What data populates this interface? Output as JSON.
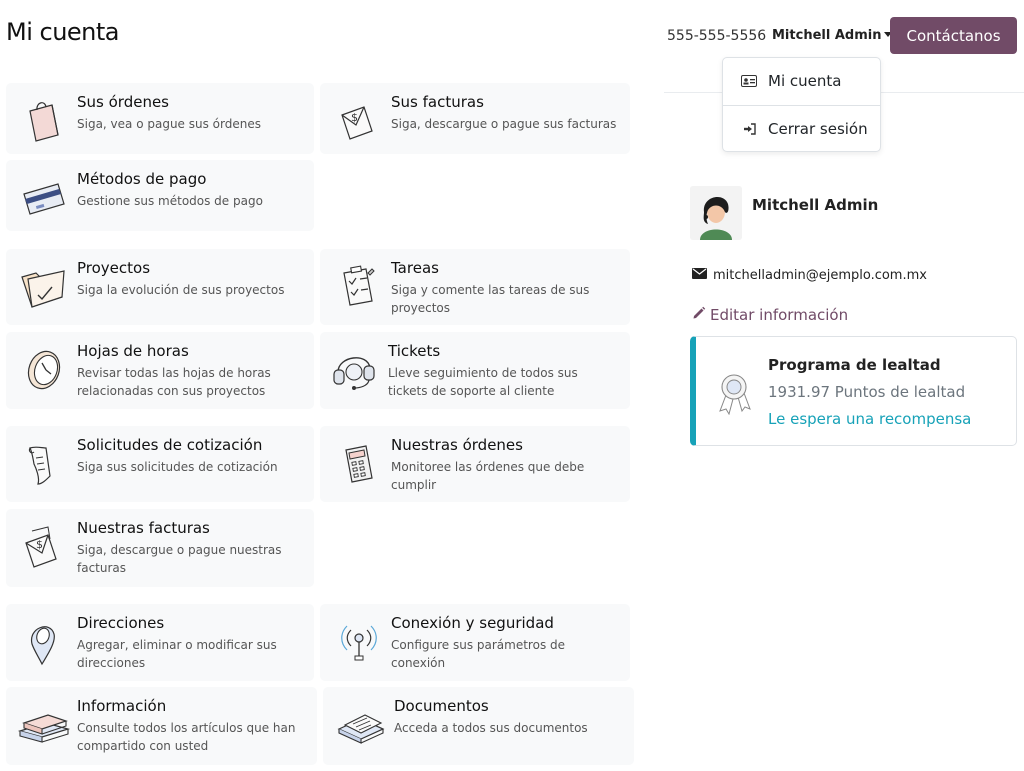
{
  "header": {
    "title": "Mi cuenta",
    "phone": "555-555-5556",
    "user_name": "Mitchell Admin",
    "contact_button": "Contáctanos"
  },
  "user_dropdown": {
    "items": [
      {
        "label": "Mi cuenta",
        "icon": "id-card-icon"
      },
      {
        "label": "Cerrar sesión",
        "icon": "sign-out-icon"
      }
    ]
  },
  "cards": [
    {
      "title": "Sus órdenes",
      "desc": "Siga, vea o pague sus órdenes",
      "icon": "shopping-bag-icon"
    },
    {
      "title": "Sus facturas",
      "desc": "Siga, descargue o pague sus facturas",
      "icon": "invoice-icon"
    },
    {
      "title": "Métodos de pago",
      "desc": "Gestione sus métodos de pago",
      "icon": "credit-card-icon"
    },
    {
      "title": "Proyectos",
      "desc": "Siga la evolución de sus proyectos",
      "icon": "folder-check-icon"
    },
    {
      "title": "Tareas",
      "desc": "Siga y comente las tareas de sus proyectos",
      "icon": "clipboard-tasks-icon"
    },
    {
      "title": "Hojas de horas",
      "desc": "Revisar todas las hojas de horas relacionadas con sus proyectos",
      "icon": "clock-icon"
    },
    {
      "title": "Tickets",
      "desc": "Lleve seguimiento de todos sus tickets de soporte al cliente",
      "icon": "headset-icon"
    },
    {
      "title": "Solicitudes de cotización",
      "desc": "Siga sus solicitudes de cotización",
      "icon": "scroll-icon"
    },
    {
      "title": "Nuestras órdenes",
      "desc": "Monitoree las órdenes que debe cumplir",
      "icon": "calculator-icon"
    },
    {
      "title": "Nuestras facturas",
      "desc": "Siga, descargue o pague nuestras facturas",
      "icon": "envelope-invoice-icon"
    },
    {
      "title": "Direcciones",
      "desc": "Agregar, eliminar o modificar sus direcciones",
      "icon": "map-pin-icon"
    },
    {
      "title": "Conexión y seguridad",
      "desc": "Configure sus parámetros de conexión",
      "icon": "security-antenna-icon"
    },
    {
      "title": "Información",
      "desc": "Consulte todos los artículos que han compartido con usted",
      "icon": "books-icon"
    },
    {
      "title": "Documentos",
      "desc": "Acceda a todos sus documentos",
      "icon": "documents-icon"
    }
  ],
  "sidebar": {
    "name": "Mitchell Admin",
    "email": "mitchelladmin@ejemplo.com.mx",
    "edit_label": "Editar información",
    "loyalty": {
      "title": "Programa de lealtad",
      "points": "1931.97 Puntos de lealtad",
      "reward": "Le espera una recompensa"
    }
  },
  "colors": {
    "primary": "#714b67",
    "accent": "#17a2b8",
    "card_bg": "#f8f9fa"
  }
}
